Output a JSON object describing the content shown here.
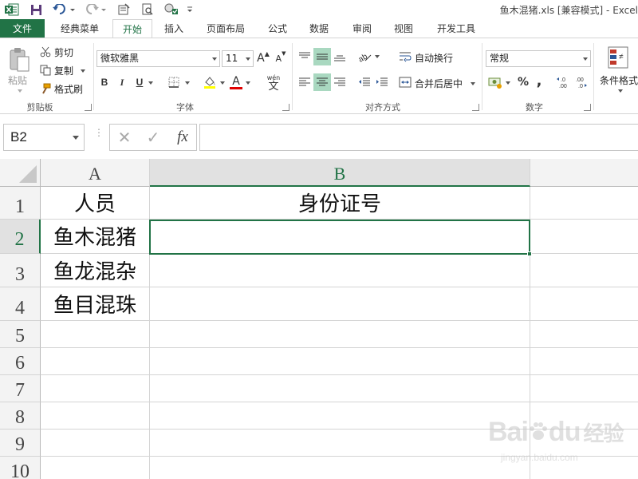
{
  "title_bar": {
    "title": "鱼木混猪.xls  [兼容模式] - Excel"
  },
  "tabs": [
    {
      "label": "文件",
      "type": "file"
    },
    {
      "label": "经典菜单",
      "type": "normal"
    },
    {
      "label": "开始",
      "type": "active"
    },
    {
      "label": "插入",
      "type": "normal"
    },
    {
      "label": "页面布局",
      "type": "normal"
    },
    {
      "label": "公式",
      "type": "normal"
    },
    {
      "label": "数据",
      "type": "normal"
    },
    {
      "label": "审阅",
      "type": "normal"
    },
    {
      "label": "视图",
      "type": "normal"
    },
    {
      "label": "开发工具",
      "type": "normal"
    }
  ],
  "ribbon": {
    "clipboard": {
      "paste": "粘贴",
      "cut": "剪切",
      "copy": "复制",
      "format_painter": "格式刷",
      "group": "剪贴板"
    },
    "font": {
      "font_name": "微软雅黑",
      "font_size": "11",
      "bold": "B",
      "italic": "I",
      "underline": "U",
      "grow": "A",
      "shrink": "A",
      "wen": "wén",
      "wen_char": "文",
      "font_color_glyph": "A",
      "group": "字体"
    },
    "alignment": {
      "wrap_text": "自动换行",
      "merge_center": "合并后居中",
      "group": "对齐方式"
    },
    "number": {
      "format": "常规",
      "percent": "%",
      "comma": ",",
      "inc_decimal": "←.0\n.00",
      "group": "数字"
    },
    "styles": {
      "conditional_format": "条件格式"
    }
  },
  "formula_bar": {
    "name_box": "B2",
    "cancel": "✕",
    "enter": "✓",
    "fx": "fx",
    "formula": ""
  },
  "sheet": {
    "columns": [
      "A",
      "B"
    ],
    "rows": [
      "1",
      "2",
      "3",
      "4",
      "5",
      "6",
      "7",
      "8",
      "9",
      "10"
    ],
    "cells": {
      "A1": "人员",
      "B1": "身份证号",
      "A2": "鱼木混猪",
      "B2": "",
      "A3": "鱼龙混杂",
      "A4": "鱼目混珠"
    },
    "selected_cell": "B2"
  },
  "watermark": {
    "brand": "Bai",
    "brand2": "du",
    "cn": "经验",
    "url": "jingyan.baidu.com"
  },
  "colors": {
    "accent": "#217346",
    "pressed": "#a9d8c0",
    "header_bg": "#f3f3f3",
    "gridline": "#d4d4d4"
  }
}
